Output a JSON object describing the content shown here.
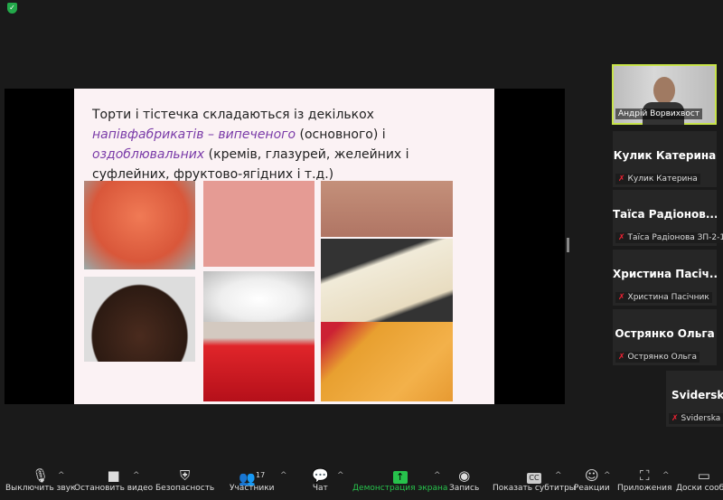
{
  "slide": {
    "text_parts": [
      "Торти і тістечка складаються із декількох ",
      "напівфабрикатів – випеченого",
      " (основного) і ",
      "оздоблювальних",
      " (кремів, глазурей, желейних і суфлейних, фруктово-ягідних і т.д.)"
    ]
  },
  "self_video": {
    "name": "Андрій Ворвихвост"
  },
  "participants": [
    {
      "display": "Кулик Катерина",
      "label": "Кулик Катерина"
    },
    {
      "display": "Таїса Радіонов...",
      "label": "Таїса Радіонова ЗП-2-1"
    },
    {
      "display": "Христина Пасіч...",
      "label": "Христина Пасічник"
    },
    {
      "display": "Острянко Ольга",
      "label": "Острянко Ольга"
    },
    {
      "display": "Sviderska",
      "label": "Sviderska Na"
    }
  ],
  "toolbar": {
    "mute": "Выключить звук",
    "video": "Остановить видео",
    "security": "Безопасность",
    "participants": "Участники",
    "participants_count": "17",
    "chat": "Чат",
    "share": "Демонстрация экрана",
    "record": "Запись",
    "captions": "Показать субтитры",
    "reactions": "Реакции",
    "apps": "Приложения",
    "whiteboards": "Доски сообщ"
  },
  "colors": {
    "accent_green": "#27c24c",
    "highlight_purple": "#7a3ba8",
    "active_speaker": "#c7e34a"
  }
}
